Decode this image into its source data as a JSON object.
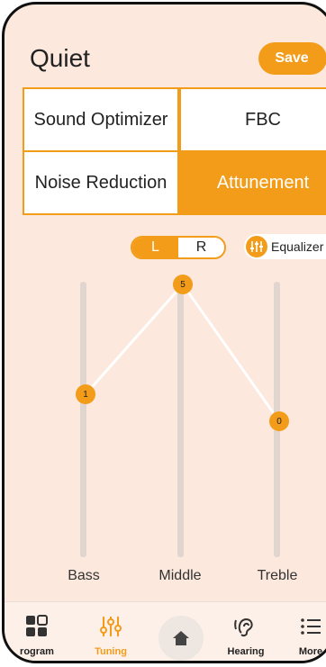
{
  "header": {
    "title": "Quiet",
    "save_label": "Save"
  },
  "mode_grid": {
    "sound_optimizer": "Sound Optimizer",
    "fbc": "FBC",
    "noise_reduction": "Noise Reduction",
    "attunement": "Attunement"
  },
  "ear_toggle": {
    "left": "L",
    "right": "R",
    "selected": "L"
  },
  "equalizer": {
    "label": "Equalizer"
  },
  "sliders": [
    {
      "name": "Bass",
      "value": "1",
      "level": 1
    },
    {
      "name": "Middle",
      "value": "5",
      "level": 5
    },
    {
      "name": "Treble",
      "value": "0",
      "level": 0
    }
  ],
  "bottom_nav": {
    "program": "rogram",
    "tuning": "Tuning",
    "hearing": "Hearing",
    "more": "More"
  },
  "colors": {
    "accent": "#f39c1a",
    "background": "#fce8dc"
  }
}
